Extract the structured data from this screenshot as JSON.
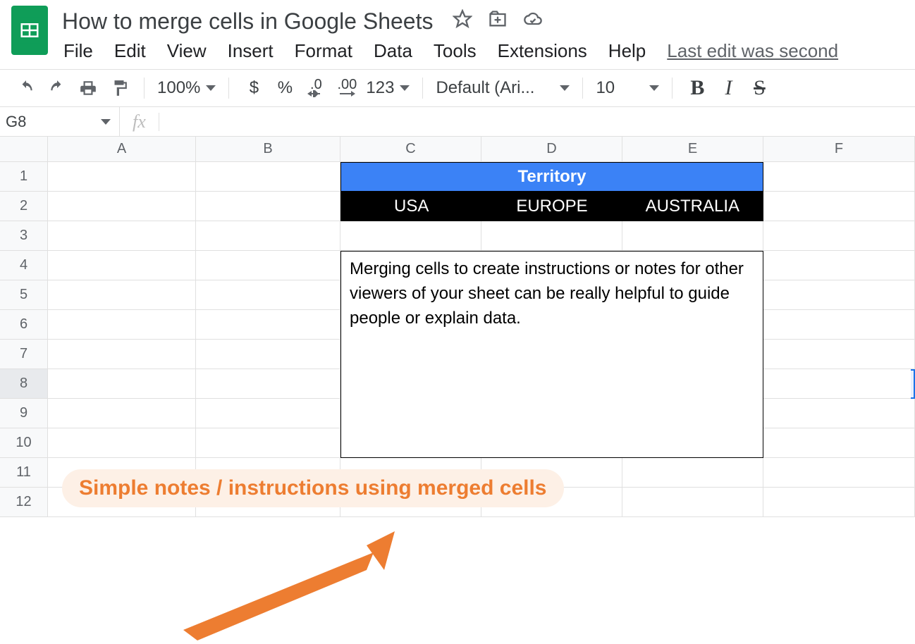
{
  "doc": {
    "title": "How to merge cells in Google Sheets"
  },
  "menu": {
    "file": "File",
    "edit": "Edit",
    "view": "View",
    "insert": "Insert",
    "format": "Format",
    "data": "Data",
    "tools": "Tools",
    "extensions": "Extensions",
    "help": "Help",
    "last_edit": "Last edit was second"
  },
  "toolbar": {
    "zoom": "100%",
    "currency": "$",
    "percent": "%",
    "dec_dec": ".0",
    "inc_dec": ".00",
    "more_fmt": "123",
    "font": "Default (Ari...",
    "font_size": "10",
    "bold": "B",
    "italic": "I",
    "strike": "S"
  },
  "namebox": {
    "ref": "G8",
    "fx": "fx"
  },
  "columns": {
    "A": "A",
    "B": "B",
    "C": "C",
    "D": "D",
    "E": "E",
    "F": "F"
  },
  "rows": [
    "1",
    "2",
    "3",
    "4",
    "5",
    "6",
    "7",
    "8",
    "9",
    "10",
    "11",
    "12"
  ],
  "sheet": {
    "territory_header": "Territory",
    "sub": {
      "c": "USA",
      "d": "EUROPE",
      "e": "AUSTRALIA"
    },
    "note": "Merging cells to create instructions or notes for other viewers of your sheet can be really helpful to guide people or explain data."
  },
  "annotation": {
    "text": "Simple notes / instructions using merged cells"
  },
  "colors": {
    "accent_orange": "#ed7d31",
    "territory_blue": "#3b82f6"
  }
}
